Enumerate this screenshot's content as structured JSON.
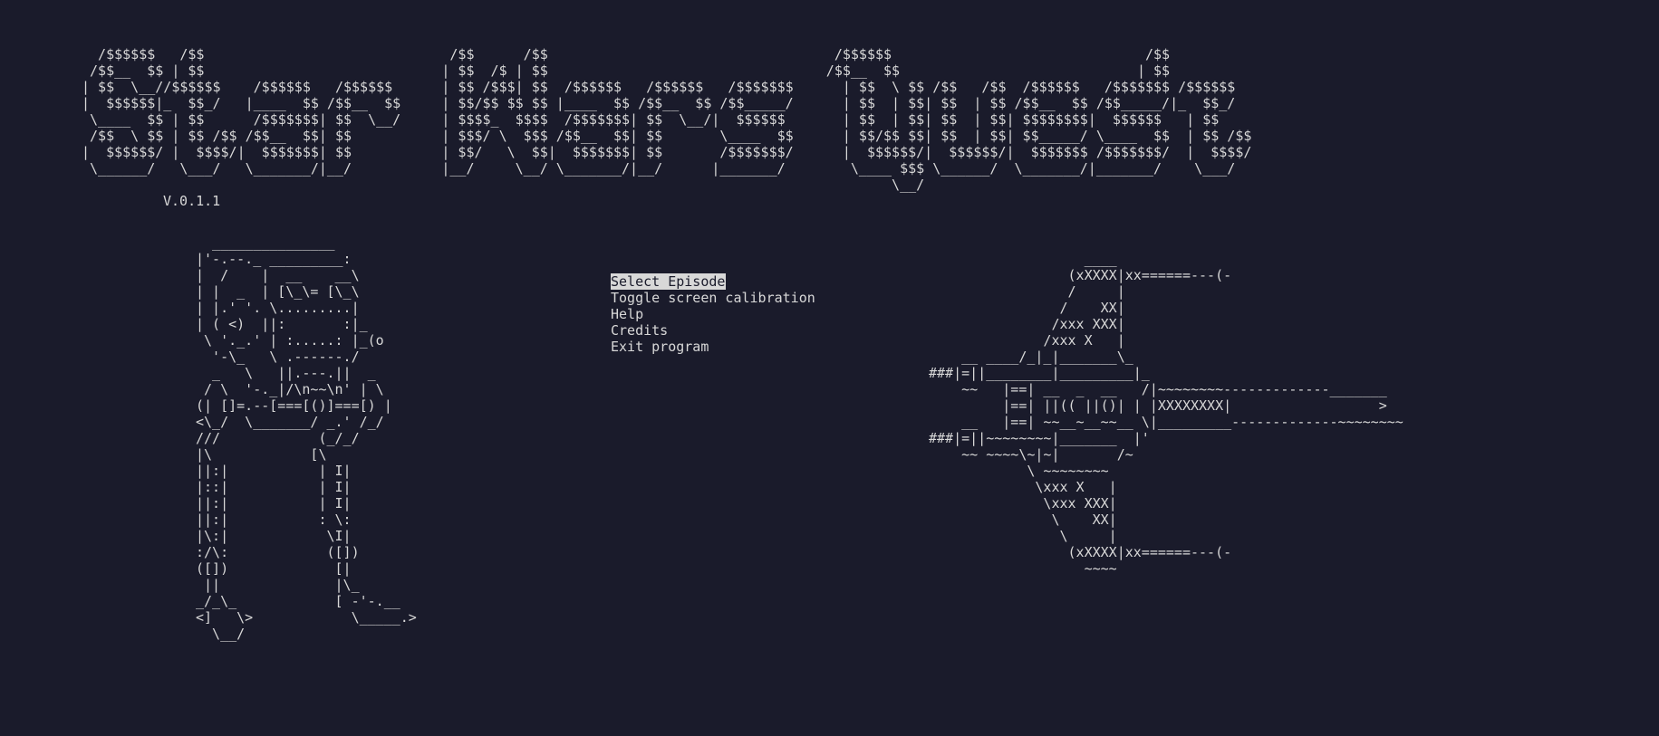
{
  "banner_art": "  /$$$$$$   /$$                              /$$      /$$                                   /$$$$$$                               /$$\n /$$__  $$ | $$                             | $$  /$ | $$                                  /$$__  $$                             | $$\n| $$  \\__//$$$$$$    /$$$$$$   /$$$$$$      | $$ /$$$| $$  /$$$$$$   /$$$$$$   /$$$$$$$      | $$  \\ $$ /$$   /$$  /$$$$$$   /$$$$$$$ /$$$$$$\n|  $$$$$$|_  $$_/   |____  $$ /$$__  $$     | $$/$$ $$ $$ |____  $$ /$$__  $$ /$$_____/      | $$  | $$| $$  | $$ /$$__  $$ /$$_____/|_  $$_/\n \\____  $$ | $$      /$$$$$$$| $$  \\__/     | $$$$_  $$$$  /$$$$$$$| $$  \\__/|  $$$$$$       | $$  | $$| $$  | $$| $$$$$$$$|  $$$$$$   | $$\n /$$  \\ $$ | $$ /$$ /$$__  $$| $$           | $$$/ \\  $$$ /$$__  $$| $$       \\____  $$      | $$/$$ $$| $$  | $$| $$_____/ \\____  $$  | $$ /$$\n|  $$$$$$/ |  $$$$/|  $$$$$$$| $$           | $$/   \\  $$|  $$$$$$$| $$       /$$$$$$$/      |  $$$$$$/|  $$$$$$/|  $$$$$$$ /$$$$$$$/  |  $$$$/\n \\______/   \\___/   \\_______/|__/           |__/     \\__/ \\_______/|__/      |_______/        \\____ $$$ \\______/  \\_______/|_______/    \\___/\n                                                                                                   \\__/",
  "version": "V.0.1.1",
  "menu": {
    "items": [
      {
        "label": "Select Episode",
        "selected": true
      },
      {
        "label": "Toggle screen calibration"
      },
      {
        "label": "Help"
      },
      {
        "label": "Credits"
      },
      {
        "label": "Exit program"
      }
    ]
  },
  "robot_art": "  _______________\n|'-.--._ _________:\n|  /    |  __    __\\\n| |  _  | [\\_\\= [\\_\\\n| |.' '. \\.........|\n| ( <)  ||:       :|_\n \\ '._.' | :.....: |_(o\n  '-\\_   \\ .------./\n  _   \\   ||.---.||  _\n / \\  '-._|/\\n~~\\n' | \\\n(| []=.--[===[()]===[) |\n<\\_/  \\_______/ _.' /_/\n///            (_/_/\n|\\            [\\\n||:|           | I|\n|::|           | I|\n||:|           | I|\n||:|           : \\:\n|\\:|            \\I|\n:/\\:            ([])\n([])             [|\n ||              |\\_\n_/_\\_            [ -'-.__\n<]   \\>            \\_____.>\n  \\__/",
  "ship_art": "                   ____\n                 (xXXXX|xx======---(-\n                 /     |\n                /    XX|\n               /xxx XXX|\n              /xxx X   |\n    __ ____/_|_|_______\\_\n###|=||________|_________|_\n    ~~   |==| __  _  __   /|~~~~~~~~-------------_______\n         |==| ||(( ||()| | |XXXXXXXX|                  >\n    __   |==| ~~__~__~~__ \\|_________-------------~~~~~~~~\n###|=||~~~~~~~~|_______  |'\n    ~~ ~~~~\\~|~|       /~\n            \\ ~~~~~~~~\n             \\xxx X   |\n              \\xxx XXX|\n               \\    XX|\n                \\     |\n                 (xXXXX|xx======---(-\n                   ~~~~"
}
